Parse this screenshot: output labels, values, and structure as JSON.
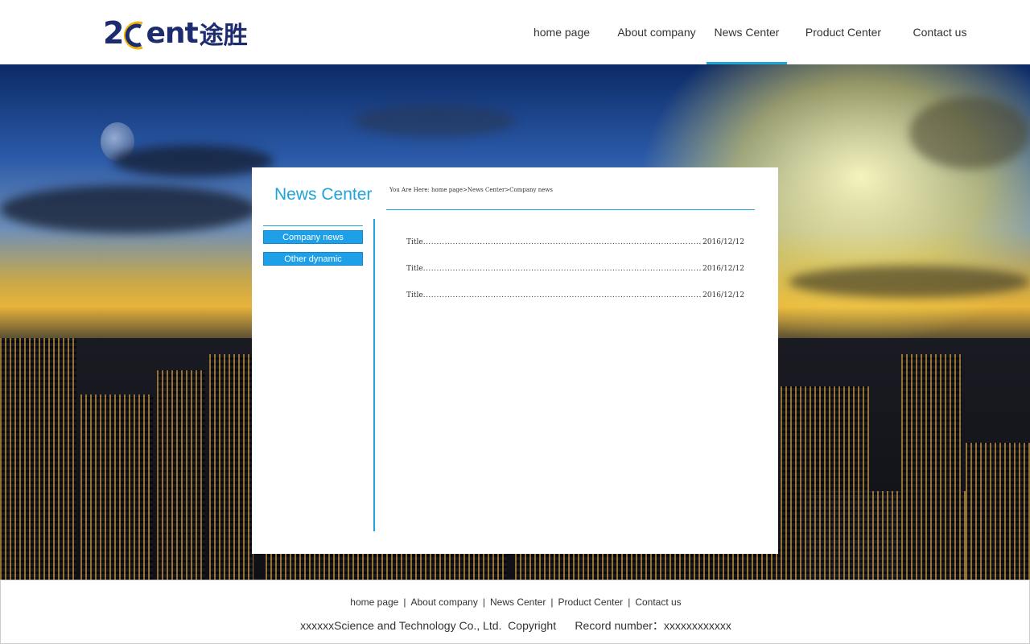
{
  "header": {
    "logo": {
      "num": "2",
      "letters": "ent",
      "cn": "途胜"
    },
    "nav": [
      {
        "label": "home page",
        "active": false
      },
      {
        "label": "About company",
        "active": false
      },
      {
        "label": "News Center",
        "active": true
      },
      {
        "label": "Product Center",
        "active": false
      },
      {
        "label": "Contact us",
        "active": false
      }
    ]
  },
  "panel": {
    "title": "News Center",
    "breadcrumb": "You Are Here: home page>News Center>Company news",
    "side_items": [
      {
        "label": "Company news"
      },
      {
        "label": "Other dynamic"
      }
    ],
    "news": [
      {
        "title": "Title",
        "date": "2016/12/12"
      },
      {
        "title": "Title",
        "date": "2016/12/12"
      },
      {
        "title": "Title",
        "date": "2016/12/12"
      }
    ]
  },
  "footer": {
    "nav": [
      "home page",
      "About company",
      "News Center",
      "Product Center",
      "Contact us"
    ],
    "copyright": "xxxxxxScience and Technology Co., Ltd.  Copyright      Record number：xxxxxxxxxxxx"
  },
  "colors": {
    "accent": "#1fa3db",
    "brand": "#1d2c6e",
    "button": "#1ea0e8",
    "logo_arc": "#f2b600"
  }
}
